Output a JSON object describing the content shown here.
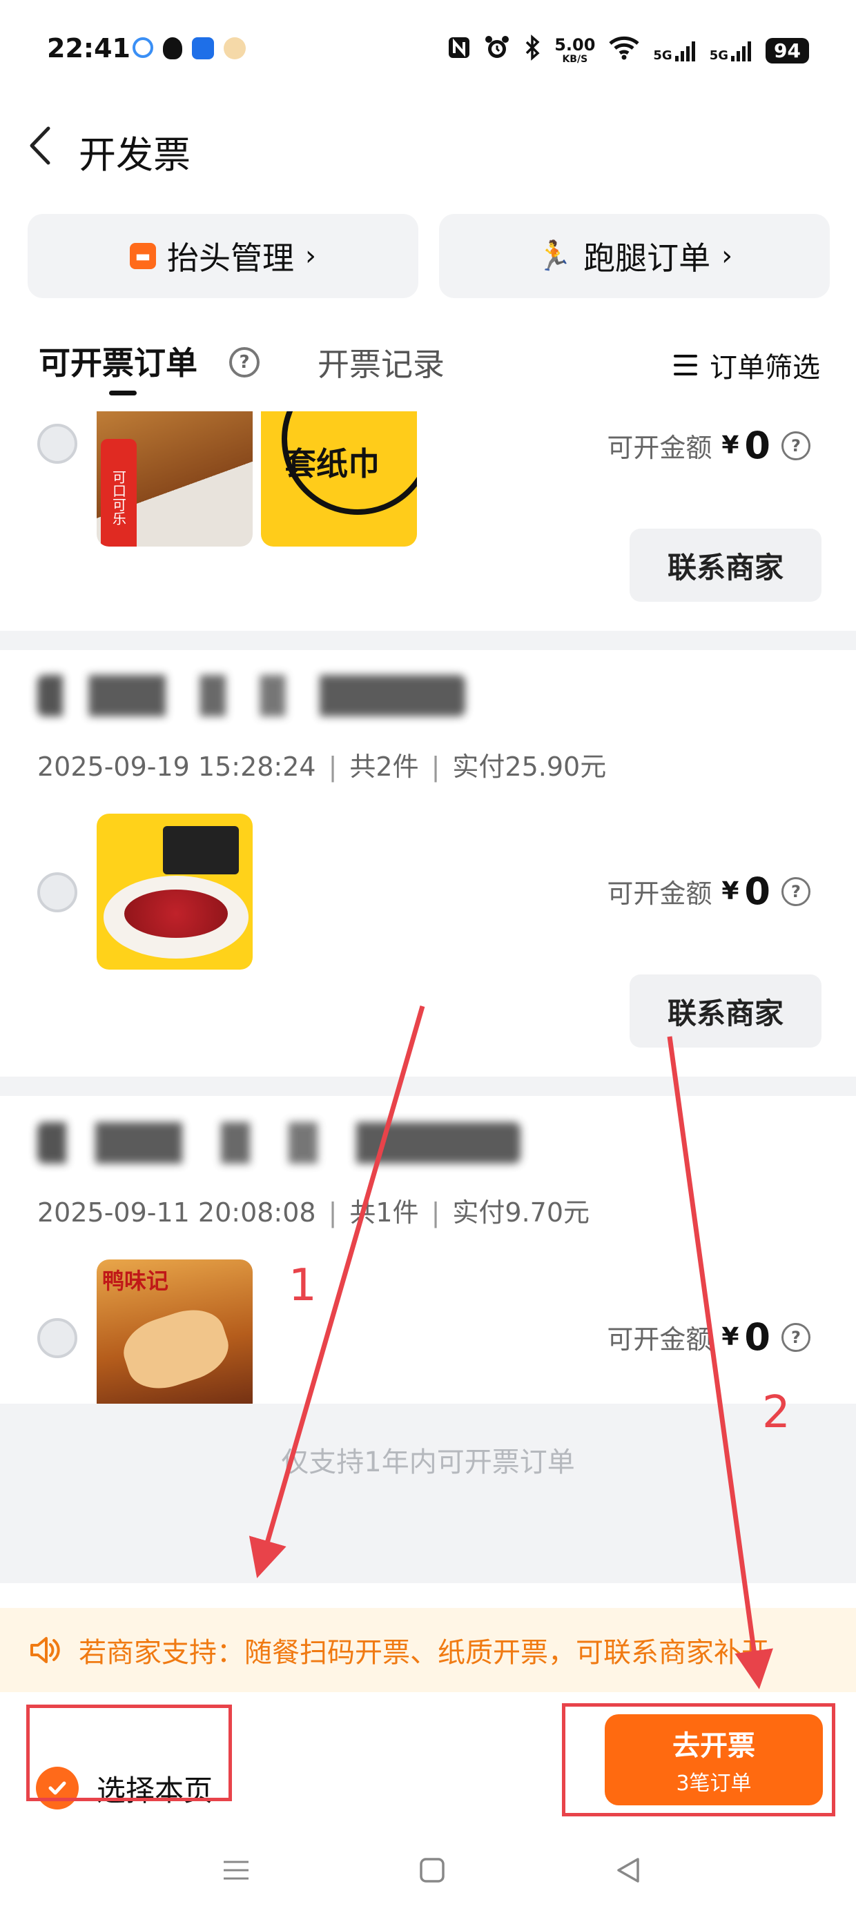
{
  "status_bar": {
    "time": "22:41",
    "speed_value": "5.00",
    "speed_unit": "KB/S",
    "net1": "5G",
    "net2": "5G",
    "battery": "94"
  },
  "header": {
    "title": "开发票"
  },
  "quick_actions": [
    {
      "label": "抬头管理",
      "icon": "invoice-title-icon"
    },
    {
      "label": "跑腿订单",
      "icon": "runner-icon"
    }
  ],
  "tabs": {
    "active": "可开票订单",
    "inactive": "开票记录",
    "filter": "订单筛选"
  },
  "orders": [
    {
      "datetime": "",
      "count": "",
      "paid": "",
      "amount_label": "可开金额",
      "currency": "¥",
      "amount": "0",
      "contact": "联系商家",
      "thumb_texts": [
        "可口可乐",
        "套纸巾"
      ]
    },
    {
      "datetime": "2025-09-19 15:28:24",
      "count": "共2件",
      "paid": "实付25.90元",
      "amount_label": "可开金额",
      "currency": "¥",
      "amount": "0",
      "contact": "联系商家"
    },
    {
      "datetime": "2025-09-11 20:08:08",
      "count": "共1件",
      "paid": "实付9.70元",
      "amount_label": "可开金额",
      "currency": "¥",
      "amount": "0",
      "thumb_text": "鸭味记"
    }
  ],
  "list_end": "仅支持1年内可开票订单",
  "notice": "若商家支持：随餐扫码开票、纸质开票，可联系商家补开",
  "bottom": {
    "select_page": "选择本页",
    "go_invoice": "去开票",
    "go_invoice_sub": "3笔订单"
  },
  "annotations": {
    "n1": "1",
    "n2": "2"
  },
  "colors": {
    "accent": "#ff6a10",
    "annotation_red": "#e8434a",
    "notice_text": "#f07a12"
  }
}
